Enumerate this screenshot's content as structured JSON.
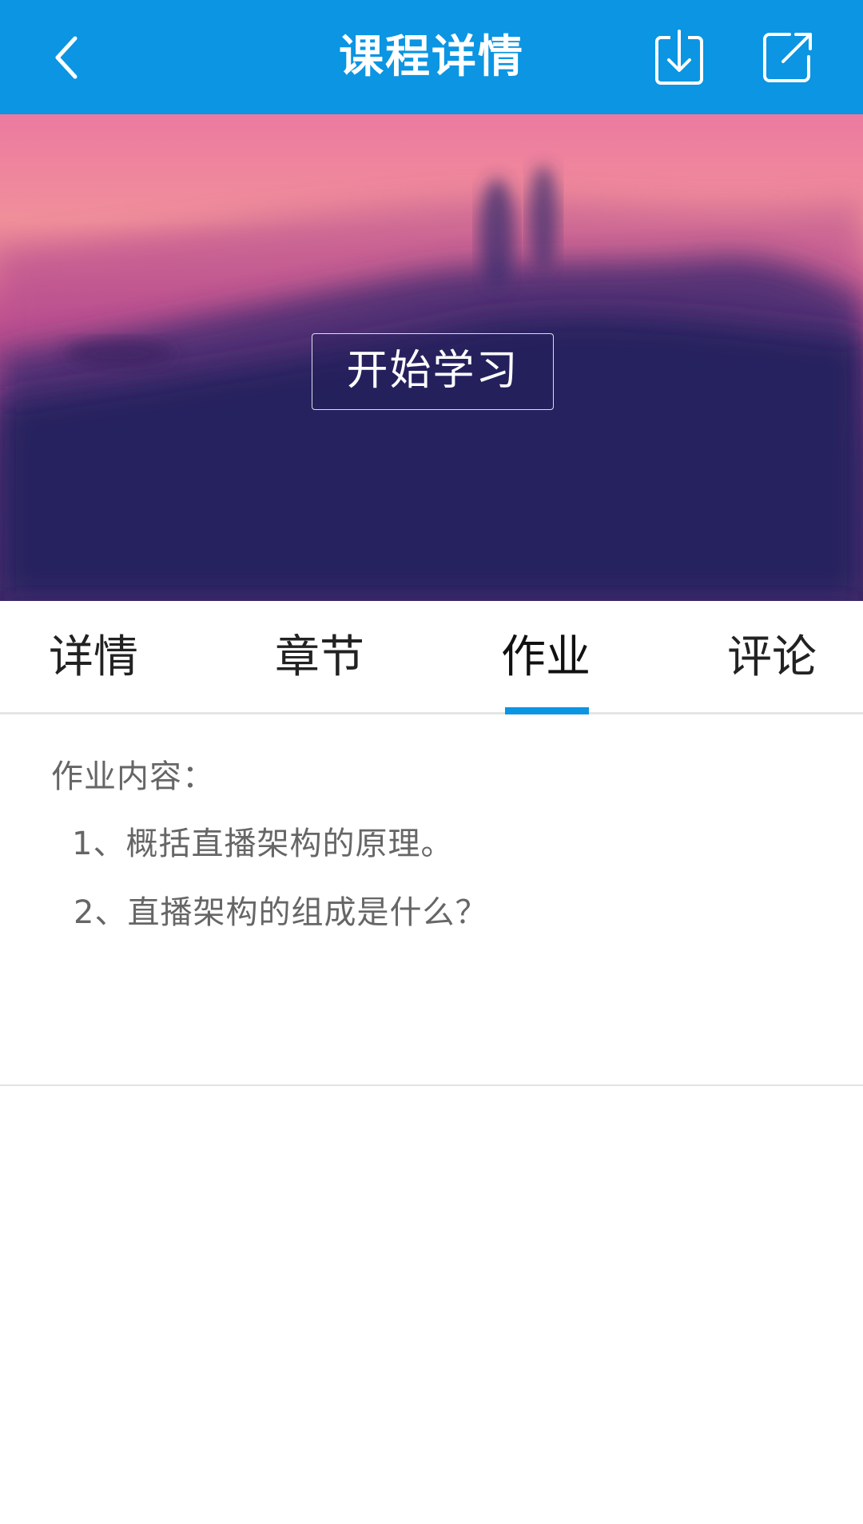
{
  "header": {
    "title": "课程详情",
    "icons": {
      "back": "chevron-left-icon",
      "download": "download-icon",
      "share": "share-external-icon"
    },
    "background_color": "#0b95e2"
  },
  "hero": {
    "start_button_label": "开始学习",
    "colors": {
      "sky_top": "#ec7aa0",
      "sky_mid": "#b6498f",
      "ground": "#27215f"
    }
  },
  "tabs": {
    "items": [
      {
        "label": "详情",
        "active": false
      },
      {
        "label": "章节",
        "active": false
      },
      {
        "label": "作业",
        "active": true
      },
      {
        "label": "评论",
        "active": false
      }
    ],
    "active_color": "#0b95e2"
  },
  "homework": {
    "heading": "作业内容：",
    "questions": [
      "1、概括直播架构的原理。",
      "2、直播架构的组成是什么？"
    ]
  }
}
